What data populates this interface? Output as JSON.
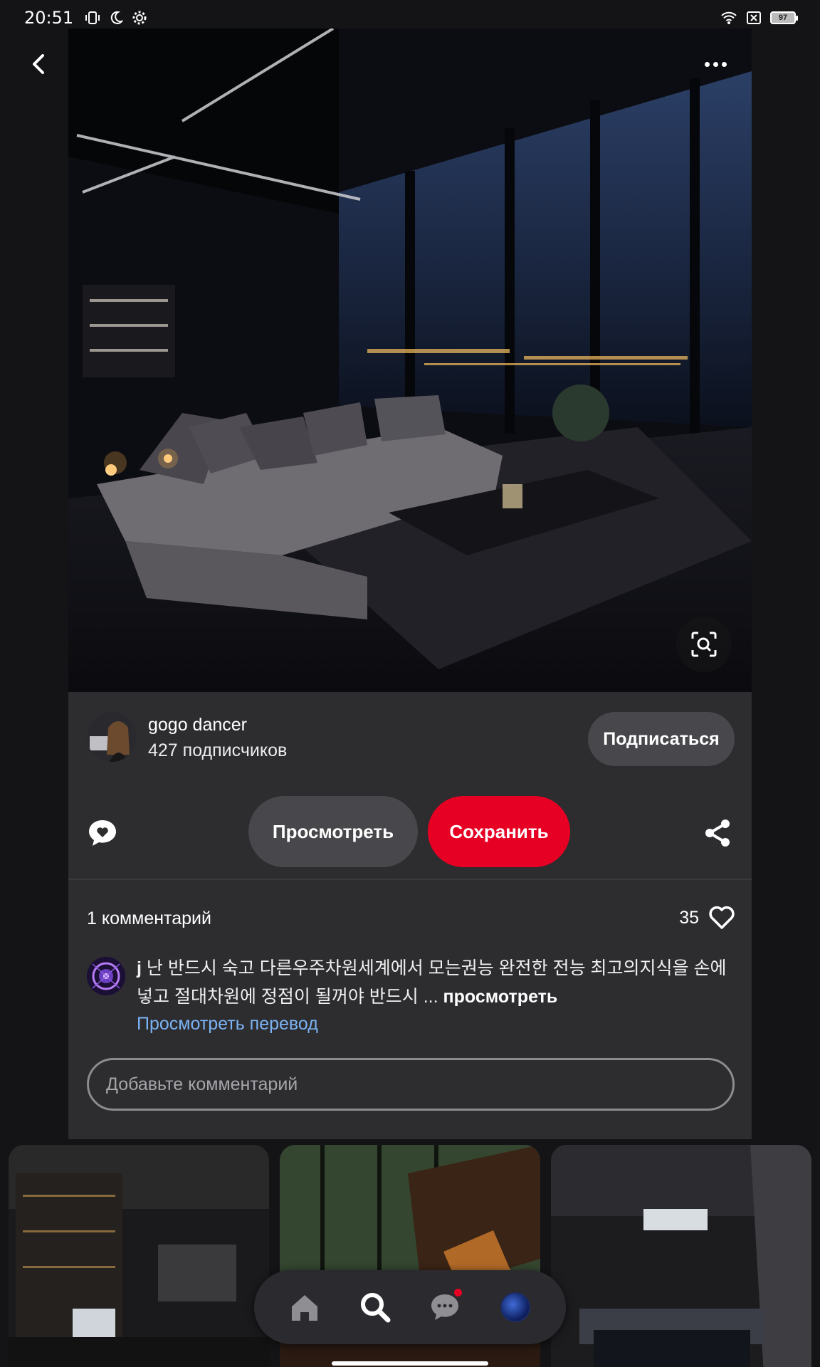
{
  "status_bar": {
    "time": "20:51",
    "battery": "97",
    "icons": [
      "vibrate-icon",
      "moon-icon",
      "gear-icon",
      "wifi-icon",
      "sim-off-icon",
      "battery-icon"
    ]
  },
  "pin": {
    "image_description_icon": "lens-icon",
    "author": {
      "name": "gogo dancer",
      "followers": "427 подписчиков",
      "follow_label": "Подписаться"
    },
    "actions": {
      "view_label": "Просмотреть",
      "save_label": "Сохранить"
    },
    "comments": {
      "count_label": "1 комментарий",
      "likes": "35",
      "items": [
        {
          "author": "j",
          "text": "난 반드시 숙고 다른우주차원세계에서 모는권능 완전한 전능 최고의지식을 손에넣고 절대차원에 정점이 될꺼야 반드시 ...",
          "more_label": "просмотреть"
        }
      ],
      "translate_label": "Просмотреть перевод",
      "input_placeholder": "Добавьте комментарий"
    }
  },
  "bottom_nav": {
    "items": [
      "home-icon",
      "search-icon",
      "chat-icon",
      "profile-avatar"
    ]
  },
  "colors": {
    "accent": "#e60023",
    "link": "#7bb2f3",
    "card_bg": "#2d2c2f",
    "page_bg": "#141416"
  }
}
